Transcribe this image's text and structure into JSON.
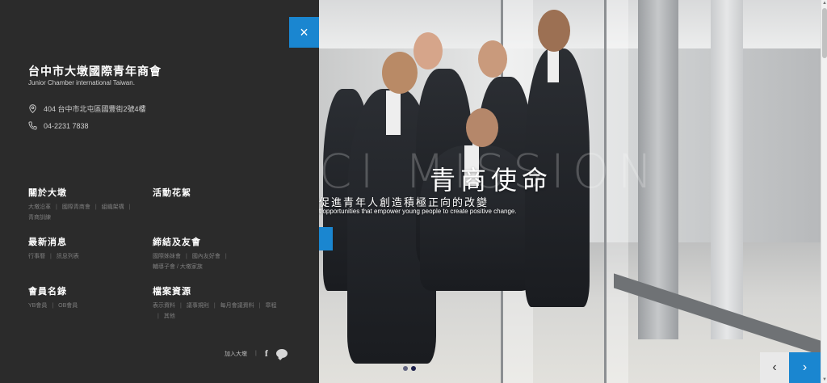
{
  "org": {
    "name": "台中市大墩國際青年商會",
    "name_en": "Junior Chamber international Taiwan."
  },
  "contact": {
    "address": "404 台中市北屯區國豐街2號4樓",
    "phone": "04-2231 7838"
  },
  "menu": {
    "about": {
      "title": "關於大墩",
      "links": [
        "大墩沿革",
        "國際青商會",
        "組織架構",
        "青商訓練"
      ]
    },
    "activities": {
      "title": "活動花絮",
      "links": []
    },
    "news": {
      "title": "最新消息",
      "links": [
        "行事曆",
        "訊息列表"
      ]
    },
    "alliance": {
      "title": "締結及友會",
      "links": [
        "國際姊妹會",
        "國內友好會",
        "輔導子會 / 大墩家族"
      ]
    },
    "members": {
      "title": "會員名錄",
      "links": [
        "YB會員",
        "OB會員"
      ]
    },
    "files": {
      "title": "檔案資源",
      "links": [
        "表示資料",
        "議事規則",
        "每月會議資料",
        "章程",
        "其他"
      ]
    }
  },
  "social": {
    "join_label": "加入大墩",
    "icons": [
      "facebook-icon",
      "line-icon"
    ]
  },
  "hero": {
    "bg_text": "CI MISSION",
    "heading": "青商使命",
    "subtitle_zh": "促進青年人創造積極正向的改變",
    "subtitle_en": "t opportunities that empower young people to create positive change."
  },
  "carousel": {
    "slides": 2,
    "active_index": 1,
    "prev_symbol": "‹",
    "next_symbol": "›"
  },
  "close_symbol": "×",
  "colors": {
    "accent": "#1a86d0",
    "panel_bg": "#2b2b2b"
  }
}
